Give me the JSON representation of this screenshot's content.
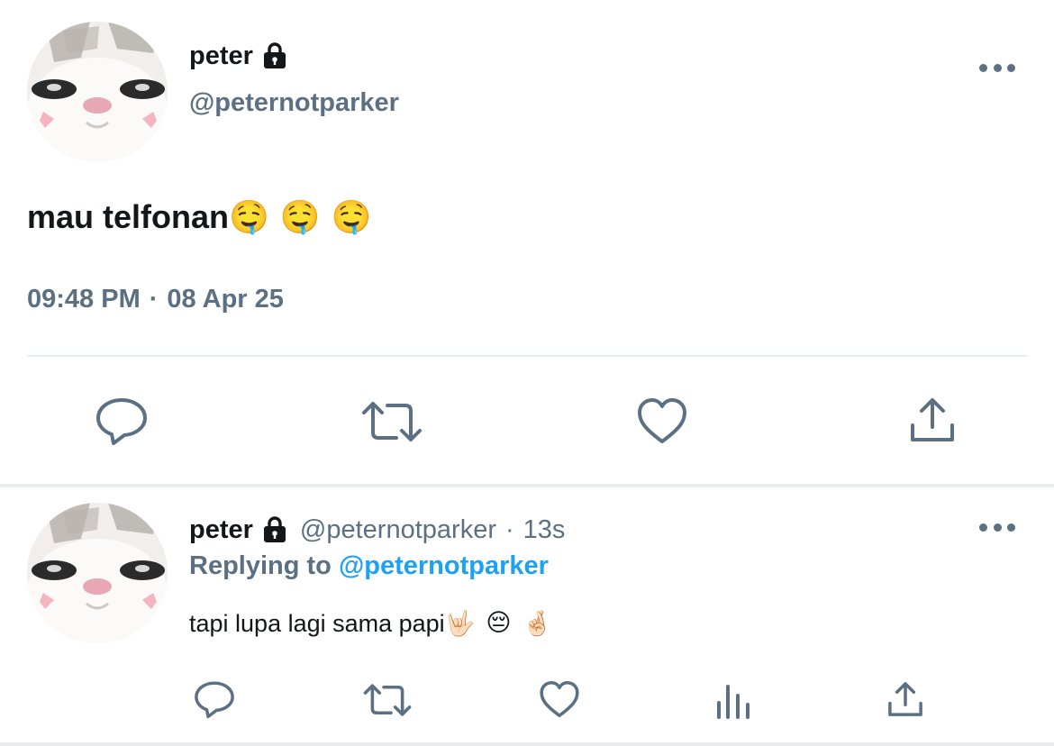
{
  "main_tweet": {
    "name": "peter",
    "handle": "@peternotparker",
    "text": "mau telfonan",
    "emojis": [
      "🤤",
      "🤤",
      "🤤"
    ],
    "time": "09:48 PM",
    "separator": "·",
    "date": "08 Apr 25",
    "actions": [
      "reply-icon",
      "retweet-icon",
      "like-icon",
      "share-icon"
    ]
  },
  "reply_tweet": {
    "name": "peter",
    "handle": "@peternotparker",
    "separator": "·",
    "time_ago": "13s",
    "replying_prefix": "Replying to",
    "replying_to": "@peternotparker",
    "text": "tapi lupa lagi sama papi",
    "emojis": [
      "🤟🏻",
      "😔",
      "🤞🏻"
    ],
    "actions": [
      "reply-icon",
      "retweet-icon",
      "like-icon",
      "analytics-icon",
      "share-icon"
    ]
  },
  "colors": {
    "text": "#14171a",
    "secondary": "#5b7083",
    "accent": "#1da1f2",
    "divider": "#e6ecf0"
  }
}
